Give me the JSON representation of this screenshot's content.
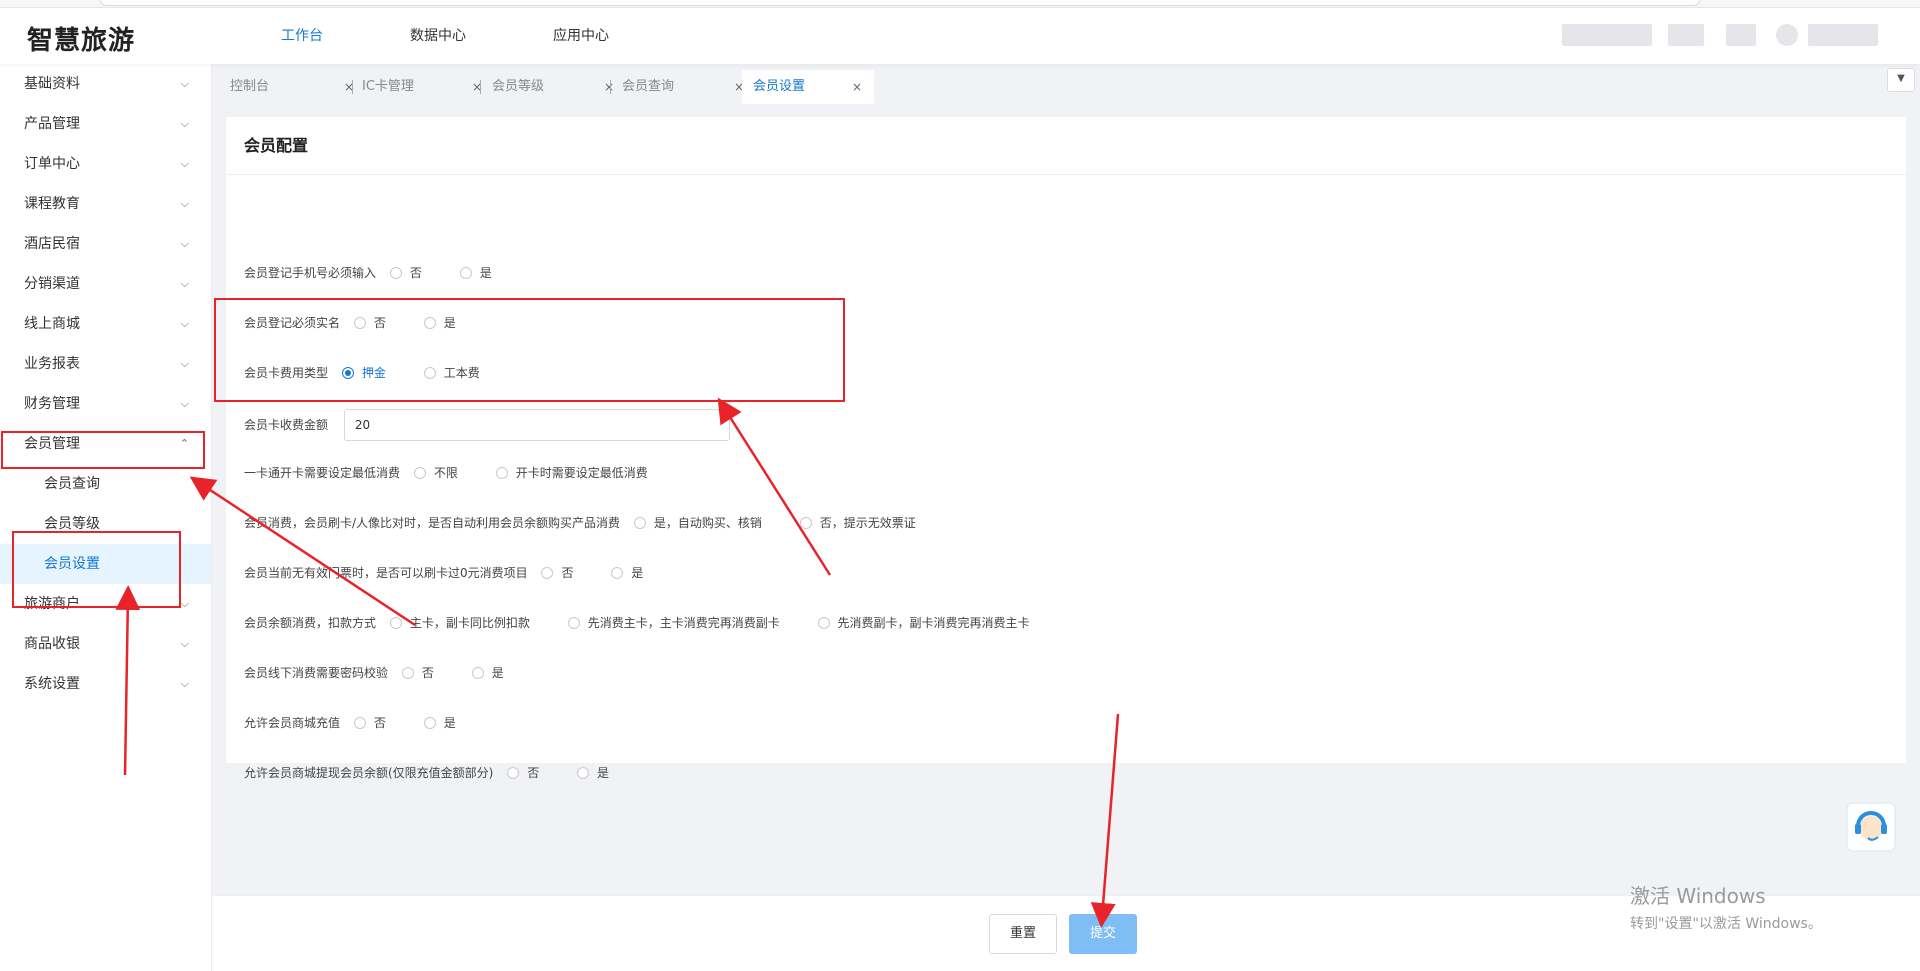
{
  "app": {
    "title": "智慧旅游"
  },
  "topnav": [
    {
      "label": "工作台",
      "active": true
    },
    {
      "label": "数据中心",
      "active": false
    },
    {
      "label": "应用中心",
      "active": false
    }
  ],
  "sidebar": {
    "items": [
      {
        "label": "基础资料"
      },
      {
        "label": "产品管理"
      },
      {
        "label": "订单中心"
      },
      {
        "label": "课程教育"
      },
      {
        "label": "酒店民宿"
      },
      {
        "label": "分销渠道"
      },
      {
        "label": "线上商城"
      },
      {
        "label": "业务报表"
      },
      {
        "label": "财务管理"
      },
      {
        "label": "会员管理",
        "expanded": true
      },
      {
        "label": "旅游商户"
      },
      {
        "label": "商品收银"
      },
      {
        "label": "系统设置"
      }
    ],
    "member_sub": [
      {
        "label": "会员查询"
      },
      {
        "label": "会员等级"
      },
      {
        "label": "会员设置",
        "active": true
      }
    ]
  },
  "tabs": [
    {
      "label": "控制台"
    },
    {
      "label": "IC卡管理"
    },
    {
      "label": "会员等级"
    },
    {
      "label": "会员查询"
    },
    {
      "label": "会员设置",
      "active": true
    }
  ],
  "icons": {
    "close": "close-icon",
    "chevron": "chevron-down-icon",
    "dropdown": "caret-down-icon",
    "support": "customer-service-icon"
  },
  "card": {
    "title": "会员配置",
    "rows": [
      {
        "label": "会员登记手机号必须输入",
        "options": [
          "否",
          "是"
        ],
        "selected": null
      },
      {
        "label": "会员登记必须实名",
        "options": [
          "否",
          "是"
        ],
        "selected": null
      },
      {
        "label": "会员卡费用类型",
        "options": [
          "押金",
          "工本费"
        ],
        "selected": 0
      },
      {
        "label": "会员卡收费金额",
        "input_value": "20"
      },
      {
        "label": "一卡通开卡需要设定最低消费",
        "options": [
          "不限",
          "开卡时需要设定最低消费"
        ],
        "selected": null
      },
      {
        "label": "会员消费，会员刷卡/人像比对时，是否自动利用会员余额购买产品消费",
        "options": [
          "是，自动购买、核销",
          "否，提示无效票证"
        ],
        "selected": null
      },
      {
        "label": "会员当前无有效门票时，是否可以刷卡过0元消费项目",
        "options": [
          "否",
          "是"
        ],
        "selected": null
      },
      {
        "label": "会员余额消费，扣款方式",
        "options": [
          "主卡，副卡同比例扣款",
          "先消费主卡，主卡消费完再消费副卡",
          "先消费副卡，副卡消费完再消费主卡"
        ],
        "selected": null
      },
      {
        "label": "会员线下消费需要密码校验",
        "options": [
          "否",
          "是"
        ],
        "selected": null
      },
      {
        "label": "允许会员商城充值",
        "options": [
          "否",
          "是"
        ],
        "selected": null
      },
      {
        "label": "允许会员商城提现会员余额(仅限充值金额部分)",
        "options": [
          "否",
          "是"
        ],
        "selected": null
      }
    ]
  },
  "footer": {
    "reset_label": "重置",
    "submit_label": "提交"
  },
  "watermark": {
    "line1": "激活 Windows",
    "line2": "转到\"设置\"以激活 Windows。"
  },
  "colors": {
    "accent": "#1677d4",
    "annotation": "#e8232a",
    "submit_bg": "#7fbdf5",
    "active_bg": "#e6f4ff"
  }
}
